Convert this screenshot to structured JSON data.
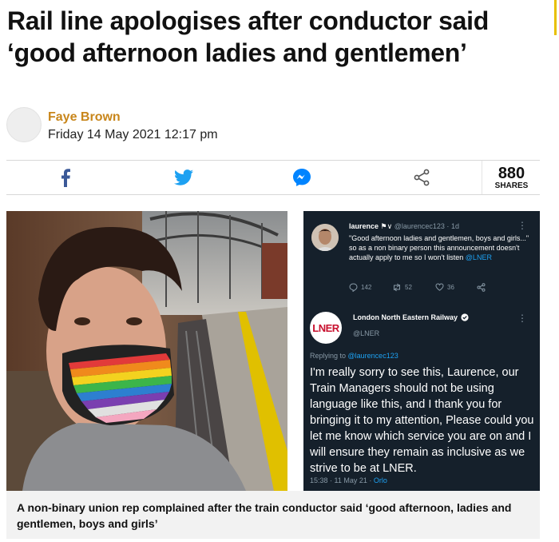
{
  "article": {
    "headline": "Rail line apologises after conductor said ‘good afternoon ladies and gentlemen’",
    "author": "Faye Brown",
    "date": "Friday 14 May 2021 12:17 pm"
  },
  "share": {
    "count": "880",
    "count_label": "SHARES",
    "icons": [
      "facebook-icon",
      "twitter-icon",
      "messenger-icon",
      "share-icon"
    ],
    "colors": {
      "facebook": "#3b5998",
      "twitter": "#1da1f2",
      "messenger": "#0084ff",
      "share": "#555555"
    }
  },
  "tweet1": {
    "name": "laurence",
    "flags": "⚑∨",
    "handle": "@laurencec123",
    "time": "1d",
    "text_before": "\"Good afternoon ladies and gentlemen, boys and girls...\" so as a non binary person this announcement doesn't actually apply to me so I won't listen ",
    "mention": "@LNER",
    "replies": "142",
    "retweets": "52",
    "likes": "36"
  },
  "tweet2": {
    "avatar_text": "LNER",
    "name": "London North Eastern Railway",
    "handle": "@LNER",
    "replying_label": "Replying to ",
    "replying_to": "@laurencec123",
    "text": "I'm really sorry to see this, Laurence, our Train Managers should not be using language like this, and I thank you for bringing it to my attention, Please could you let me know which service you are on and I will ensure they remain as inclusive as we strive to be at LNER.",
    "timestamp": "15:38 · 11 May 21 · ",
    "client": "Orlo"
  },
  "caption": "A non-binary union rep complained after the train conductor said ‘good afternoon, ladies and gentlemen, boys and girls’"
}
